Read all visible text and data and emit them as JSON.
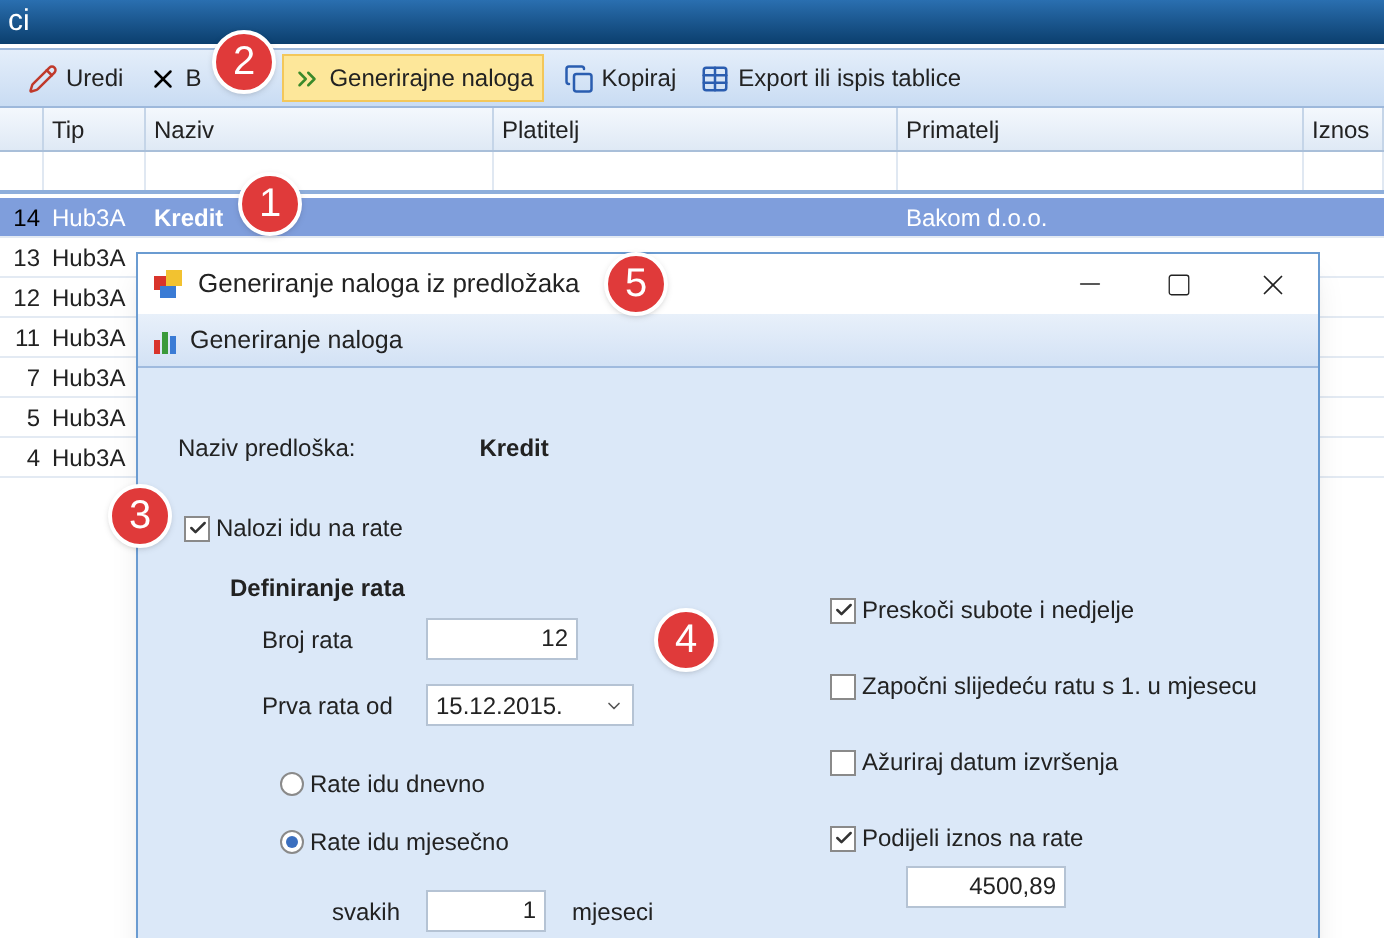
{
  "window": {
    "title": "ci"
  },
  "toolbar": [
    {
      "label": "Uredi",
      "kind": "edit",
      "highlighted": false
    },
    {
      "label": "B",
      "kind": "delete",
      "highlighted": false
    },
    {
      "label": "Generirajne naloga",
      "kind": "generate",
      "highlighted": true
    },
    {
      "label": "Kopiraj",
      "kind": "copy",
      "highlighted": false
    },
    {
      "label": "Export ili ispis tablice",
      "kind": "table",
      "highlighted": false
    }
  ],
  "table": {
    "columns": [
      "Tip",
      "Naziv",
      "Platitelj",
      "Primatelj",
      "Iznos"
    ],
    "rows": [
      {
        "num": "14",
        "tip": "Hub3A",
        "naziv": "Kredit",
        "primatelj": "Bakom d.o.o.",
        "selected": true
      },
      {
        "num": "13",
        "tip": "Hub3A",
        "selected": false
      },
      {
        "num": "12",
        "tip": "Hub3A",
        "selected": false
      },
      {
        "num": "11",
        "tip": "Hub3A",
        "selected": false
      },
      {
        "num": "7",
        "tip": "Hub3A",
        "selected": false
      },
      {
        "num": "5",
        "tip": "Hub3A",
        "selected": false
      },
      {
        "num": "4",
        "tip": "Hub3A",
        "selected": false
      }
    ]
  },
  "dialog": {
    "title": "Generiranje naloga iz predložaka",
    "ribbon": "Generiranje naloga",
    "template_label": "Naziv predloška:",
    "template_value": "Kredit",
    "installments": {
      "label": "Nalozi idu na rate",
      "checked": true
    },
    "section": "Definiranje rata",
    "count": {
      "label": "Broj rata",
      "value": "12"
    },
    "first": {
      "label": "Prva rata od",
      "value": "15.12.2015."
    },
    "radios": [
      {
        "label": "Rate idu dnevno",
        "selected": false
      },
      {
        "label": "Rate idu mjesečno",
        "selected": true
      }
    ],
    "every": {
      "label": "svakih",
      "value": "1",
      "unit": "mjeseci"
    },
    "options": [
      {
        "label": "Preskoči  subote i nedjelje",
        "checked": true
      },
      {
        "label": "Započni slijedeću ratu s 1. u mjesecu",
        "checked": false
      },
      {
        "label": "Ažuriraj datum izvršenja",
        "checked": false
      },
      {
        "label": "Podijeli iznos na rate",
        "checked": true
      }
    ],
    "amount": "4500,89"
  },
  "callouts": [
    "1",
    "2",
    "3",
    "4",
    "5"
  ]
}
